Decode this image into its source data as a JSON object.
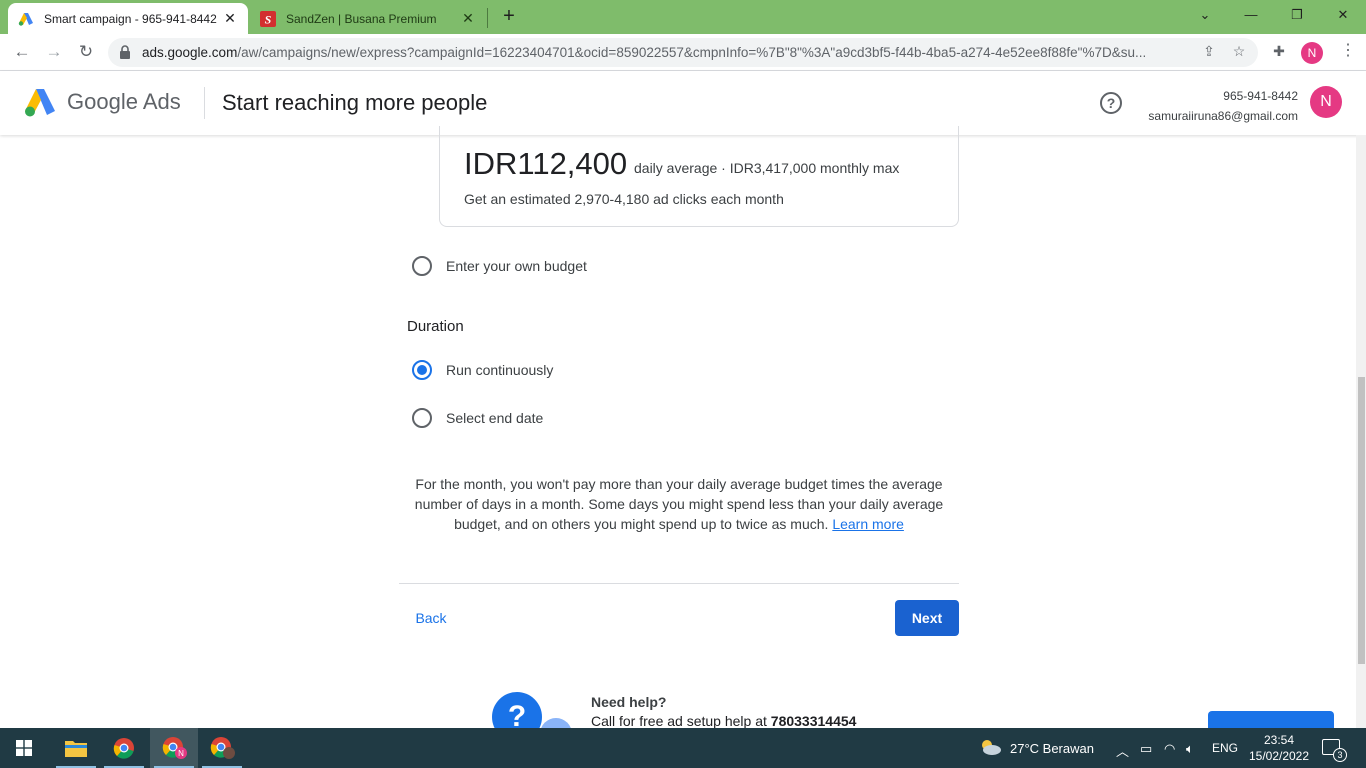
{
  "browser": {
    "tabs": [
      {
        "title": "Smart campaign - 965-941-8442",
        "active": true
      },
      {
        "title": "SandZen | Busana Premium",
        "active": false
      }
    ],
    "new_tab": "+",
    "url_host": "ads.google.com",
    "url_path": "/aw/campaigns/new/express?campaignId=16223404701&ocid=859022557&cmpnInfo=%7B\"8\"%3A\"a9cd3bf5-f44b-4ba5-a274-4e52ee8f88fe\"%7D&su...",
    "profile_initial": "N"
  },
  "header": {
    "brand": "Google Ads",
    "page_title": "Start reaching more people",
    "account_id": "965-941-8442",
    "account_email": "samuraiiruna86@gmail.com",
    "avatar_initial": "N"
  },
  "budget": {
    "amount": "IDR112,400",
    "daily_line": "daily average ·  IDR3,417,000 monthly max",
    "estimate": "Get an estimated 2,970-4,180 ad clicks each month",
    "own_budget_label": "Enter your own budget"
  },
  "duration": {
    "title": "Duration",
    "options": [
      {
        "label": "Run continuously",
        "checked": true
      },
      {
        "label": "Select end date",
        "checked": false
      }
    ]
  },
  "info": {
    "text": "For the month, you won't pay more than your daily average budget times the average number of days in a month. Some days you might spend less than your daily average budget, and on others you might spend up to twice as much.",
    "link": "Learn more"
  },
  "nav": {
    "back": "Back",
    "next": "Next"
  },
  "help": {
    "title": "Need help?",
    "call_text": "Call for free ad setup help at",
    "phone": "78033314454"
  },
  "taskbar": {
    "weather": "27°C  Berawan",
    "lang": "ENG",
    "time": "23:54",
    "date": "15/02/2022",
    "notifications": "3"
  },
  "colors": {
    "tabstrip": "#7fbc6b",
    "accent": "#1a73e8",
    "next_button": "#1a62d0",
    "avatar": "#e53983",
    "taskbar": "#203a44"
  }
}
